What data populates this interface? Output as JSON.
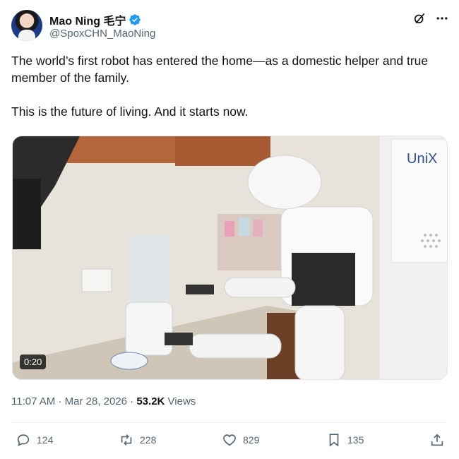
{
  "author": {
    "display_name": "Mao Ning 毛宁",
    "handle": "@SpoxCHN_MaoNing",
    "verified": true
  },
  "tweet": {
    "paragraphs": [
      "The world’s first robot has entered the home—as a domestic helper and true member of the family.",
      "This is the future of living. And it starts now."
    ]
  },
  "media": {
    "type": "video",
    "duration": "0:20",
    "brand_text": "UniX"
  },
  "meta": {
    "time": "11:07 AM",
    "date": "Mar 28, 2026",
    "separator": "·",
    "views_count": "53.2K",
    "views_label": "Views"
  },
  "actions": {
    "replies": "124",
    "reposts": "228",
    "likes": "829",
    "bookmarks": "135"
  },
  "colors": {
    "verified": "#1d9bf0",
    "secondary_text": "#536471",
    "primary_text": "#0f1419"
  }
}
